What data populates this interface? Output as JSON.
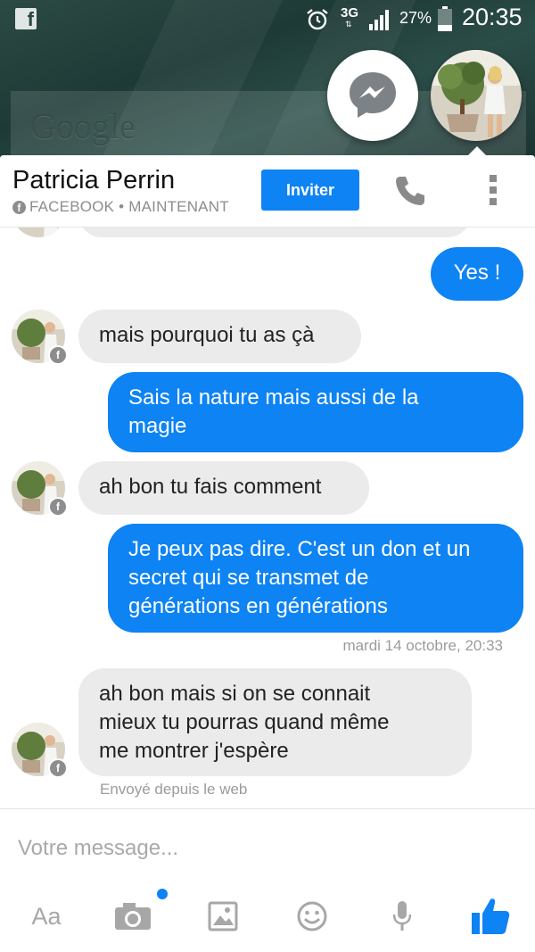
{
  "status_bar": {
    "network": "3G",
    "battery_percent": "27%",
    "time": "20:35",
    "icons": [
      "facebook-notification-icon",
      "alarm-icon",
      "signal-icon",
      "battery-icon"
    ]
  },
  "homescreen": {
    "search_logo": "Google"
  },
  "chat_heads": {
    "messenger_icon": "messenger-bolt-icon",
    "contact_avatar": "contact-photo"
  },
  "header": {
    "name": "Patricia Perrin",
    "source": "FACEBOOK",
    "separator": "•",
    "presence": "MAINTENANT",
    "invite_label": "Inviter",
    "phone_icon": "phone-icon",
    "more_icon": "overflow-menu-icon"
  },
  "messages": [
    {
      "direction": "out",
      "text": "Yes !"
    },
    {
      "direction": "in",
      "text": "mais pourquoi tu as çà"
    },
    {
      "direction": "out",
      "text": "Sais la nature mais aussi de la\nmagie"
    },
    {
      "direction": "in",
      "text": "ah bon tu fais comment"
    },
    {
      "direction": "out",
      "text": "Je peux pas dire. C'est un don et un\nsecret qui se transmet de\ngénérations en générations"
    },
    {
      "direction": "in",
      "text": "ah bon mais si on se connait\nmieux tu pourras quand même\nme montrer j'espère"
    }
  ],
  "timestamp": "mardi 14 octobre, 20:33",
  "sent_from": "Envoyé depuis le web",
  "composer": {
    "placeholder": "Votre message...",
    "text_label": "Aa",
    "tools": [
      "text-format-icon",
      "camera-icon",
      "gallery-icon",
      "emoji-icon",
      "microphone-icon",
      "like-thumb-icon"
    ]
  },
  "colors": {
    "accent": "#0d83f4",
    "incoming_bubble": "#ebebeb",
    "muted_text": "#8d8d8d"
  }
}
